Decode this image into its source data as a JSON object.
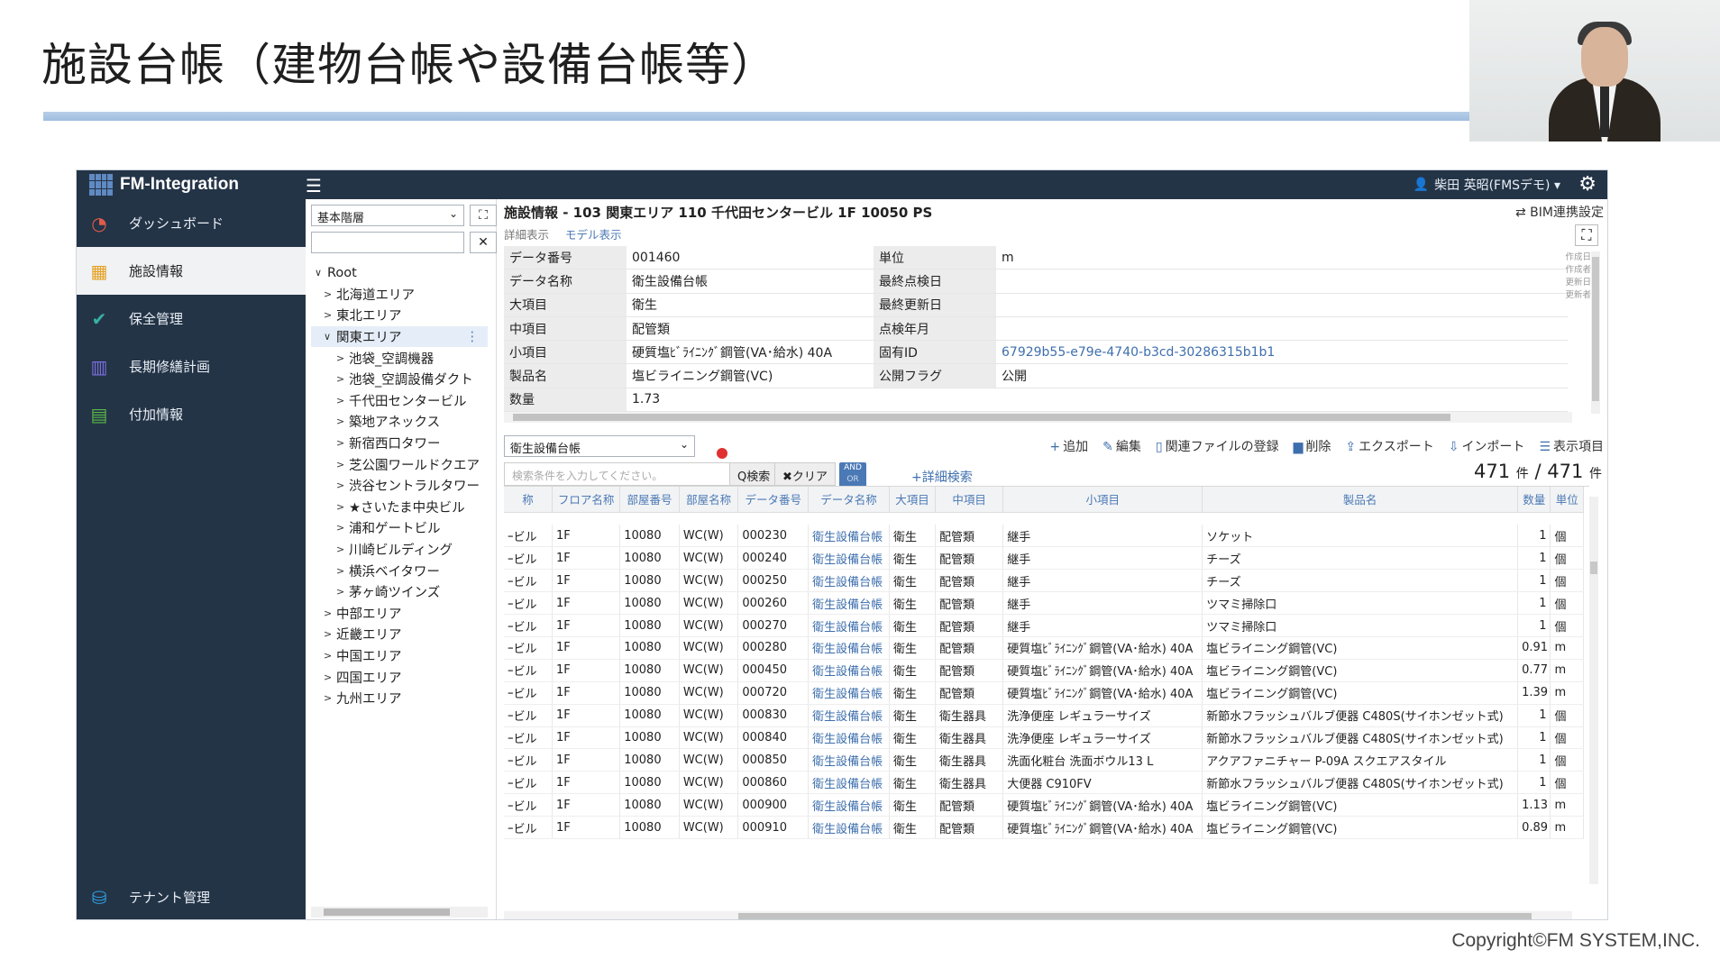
{
  "slide": {
    "title": "施設台帳（建物台帳や設備台帳等）",
    "copyright": "Copyright©FM SYSTEM,INC."
  },
  "app": {
    "brand": "FM-Integration",
    "user": "柴田 英昭(FMSデモ) ▾",
    "sidebar": [
      {
        "label": "ダッシュボード",
        "icon": "gauge-icon",
        "glyph": "◔",
        "color": "#e05a4a"
      },
      {
        "label": "施設情報",
        "icon": "building-icon",
        "glyph": "▦",
        "color": "#e5a020"
      },
      {
        "label": "保全管理",
        "icon": "check-icon",
        "glyph": "✔",
        "color": "#37b1a6"
      },
      {
        "label": "長期修繕計画",
        "icon": "bar-chart-icon",
        "glyph": "▥",
        "color": "#7d6fe0"
      },
      {
        "label": "付加情報",
        "icon": "list-icon",
        "glyph": "▤",
        "color": "#58b848"
      }
    ],
    "sidebar_bottom": {
      "label": "テナント管理",
      "icon": "database-icon",
      "glyph": "⛁",
      "color": "#2ea0e0"
    },
    "tree": {
      "select_value": "基本階層",
      "nodes": [
        {
          "label": "Root",
          "level": 0,
          "chev": "∨"
        },
        {
          "label": "北海道エリア",
          "level": 1,
          "chev": ">"
        },
        {
          "label": "東北エリア",
          "level": 1,
          "chev": ">"
        },
        {
          "label": "関東エリア",
          "level": 1,
          "chev": "∨",
          "highlight": true
        },
        {
          "label": "池袋_空調機器",
          "level": 2,
          "chev": ">"
        },
        {
          "label": "池袋_空調設備ダクト",
          "level": 2,
          "chev": ">"
        },
        {
          "label": "千代田センタービル",
          "level": 2,
          "chev": ">"
        },
        {
          "label": "築地アネックス",
          "level": 2,
          "chev": ">"
        },
        {
          "label": "新宿西口タワー",
          "level": 2,
          "chev": ">"
        },
        {
          "label": "芝公園ワールドクエア",
          "level": 2,
          "chev": ">"
        },
        {
          "label": "渋谷セントラルタワー",
          "level": 2,
          "chev": ">"
        },
        {
          "label": "★さいたま中央ビル",
          "level": 2,
          "chev": ">"
        },
        {
          "label": "浦和ゲートビル",
          "level": 2,
          "chev": ">"
        },
        {
          "label": "川崎ビルディング",
          "level": 2,
          "chev": ">"
        },
        {
          "label": "横浜ベイタワー",
          "level": 2,
          "chev": ">"
        },
        {
          "label": "茅ヶ崎ツインズ",
          "level": 2,
          "chev": ">"
        },
        {
          "label": "中部エリア",
          "level": 1,
          "chev": ">"
        },
        {
          "label": "近畿エリア",
          "level": 1,
          "chev": ">"
        },
        {
          "label": "中国エリア",
          "level": 1,
          "chev": ">"
        },
        {
          "label": "四国エリア",
          "level": 1,
          "chev": ">"
        },
        {
          "label": "九州エリア",
          "level": 1,
          "chev": ">"
        }
      ]
    },
    "main": {
      "breadcrumb": "施設情報 - 103 関東エリア 110 千代田センタービル 1F 10050 PS",
      "bim_link": "⇄ BIM連携設定",
      "tabs": [
        "詳細表示",
        "モデル表示"
      ],
      "detail_rows": [
        {
          "k1": "データ番号",
          "v1": "001460",
          "k2": "単位",
          "v2": "m"
        },
        {
          "k1": "データ名称",
          "v1": "衛生設備台帳",
          "k2": "最終点検日",
          "v2": ""
        },
        {
          "k1": "大項目",
          "v1": "衛生",
          "k2": "最終更新日",
          "v2": ""
        },
        {
          "k1": "中項目",
          "v1": "配管類",
          "k2": "点検年月",
          "v2": ""
        },
        {
          "k1": "小項目",
          "v1": "硬質塩ﾋﾞﾗｲﾆﾝｸﾞ鋼管(VA･給水) 40A",
          "k2": "固有ID",
          "v2": "67929b55-e79e-4740-b3cd-30286315b1b1"
        },
        {
          "k1": "製品名",
          "v1": "塩ビライニング鋼管(VC)",
          "k2": "公開フラグ",
          "v2": "公開"
        },
        {
          "k1": "数量",
          "v1": "1.73",
          "k2": "",
          "v2": ""
        }
      ],
      "meta": [
        "作成日",
        "作成者",
        "更新日",
        "更新者"
      ],
      "list_select": "衛生設備台帳",
      "toolbar": [
        {
          "icon": "plus-icon",
          "glyph": "+",
          "label": "追加"
        },
        {
          "icon": "pencil-icon",
          "glyph": "✎",
          "label": "編集"
        },
        {
          "icon": "file-icon",
          "glyph": "▯",
          "label": "関連ファイルの登録"
        },
        {
          "icon": "trash-icon",
          "glyph": "▆",
          "label": "削除"
        },
        {
          "icon": "export-icon",
          "glyph": "⇪",
          "label": "エクスポート"
        },
        {
          "icon": "import-icon",
          "glyph": "⇩",
          "label": "インポート"
        },
        {
          "icon": "columns-icon",
          "glyph": "☰",
          "label": "表示項目"
        }
      ],
      "search_placeholder": "検索条件を入力してください。",
      "search_btn": "Q検索",
      "clear_btn": "✖クリア",
      "andor": [
        "AND",
        "OR"
      ],
      "advanced_search": "+詳細検索",
      "count": {
        "shown": "471",
        "total": "471",
        "unit": "件",
        "sep": "/"
      },
      "columns": [
        "称",
        "フロア名称",
        "部屋番号",
        "部屋名称",
        "データ番号",
        "データ名称",
        "大項目",
        "中項目",
        "小項目",
        "製品名",
        "数量",
        "単位"
      ],
      "rows": [
        [
          "ｰビル",
          "1F",
          "10080",
          "WC(W)",
          "000230",
          "衛生設備台帳",
          "衛生",
          "配管類",
          "継手",
          "ソケット",
          "1",
          "個"
        ],
        [
          "ｰビル",
          "1F",
          "10080",
          "WC(W)",
          "000240",
          "衛生設備台帳",
          "衛生",
          "配管類",
          "継手",
          "チーズ",
          "1",
          "個"
        ],
        [
          "ｰビル",
          "1F",
          "10080",
          "WC(W)",
          "000250",
          "衛生設備台帳",
          "衛生",
          "配管類",
          "継手",
          "チーズ",
          "1",
          "個"
        ],
        [
          "ｰビル",
          "1F",
          "10080",
          "WC(W)",
          "000260",
          "衛生設備台帳",
          "衛生",
          "配管類",
          "継手",
          "ツマミ掃除口",
          "1",
          "個"
        ],
        [
          "ｰビル",
          "1F",
          "10080",
          "WC(W)",
          "000270",
          "衛生設備台帳",
          "衛生",
          "配管類",
          "継手",
          "ツマミ掃除口",
          "1",
          "個"
        ],
        [
          "ｰビル",
          "1F",
          "10080",
          "WC(W)",
          "000280",
          "衛生設備台帳",
          "衛生",
          "配管類",
          "硬質塩ﾋﾞﾗｲﾆﾝｸﾞ鋼管(VA･給水) 40A",
          "塩ビライニング鋼管(VC)",
          "0.91",
          "m"
        ],
        [
          "ｰビル",
          "1F",
          "10080",
          "WC(W)",
          "000450",
          "衛生設備台帳",
          "衛生",
          "配管類",
          "硬質塩ﾋﾞﾗｲﾆﾝｸﾞ鋼管(VA･給水) 40A",
          "塩ビライニング鋼管(VC)",
          "0.77",
          "m"
        ],
        [
          "ｰビル",
          "1F",
          "10080",
          "WC(W)",
          "000720",
          "衛生設備台帳",
          "衛生",
          "配管類",
          "硬質塩ﾋﾞﾗｲﾆﾝｸﾞ鋼管(VA･給水) 40A",
          "塩ビライニング鋼管(VC)",
          "1.39",
          "m"
        ],
        [
          "ｰビル",
          "1F",
          "10080",
          "WC(W)",
          "000830",
          "衛生設備台帳",
          "衛生",
          "衛生器具",
          "洗浄便座 レギュラーサイズ",
          "新節水フラッシュバルブ便器 C480S(サイホンゼット式)",
          "1",
          "個"
        ],
        [
          "ｰビル",
          "1F",
          "10080",
          "WC(W)",
          "000840",
          "衛生設備台帳",
          "衛生",
          "衛生器具",
          "洗浄便座 レギュラーサイズ",
          "新節水フラッシュバルブ便器 C480S(サイホンゼット式)",
          "1",
          "個"
        ],
        [
          "ｰビル",
          "1F",
          "10080",
          "WC(W)",
          "000850",
          "衛生設備台帳",
          "衛生",
          "衛生器具",
          "洗面化粧台 洗面ボウル13 L",
          "アクアファニチャー P-09A スクエアスタイル",
          "1",
          "個"
        ],
        [
          "ｰビル",
          "1F",
          "10080",
          "WC(W)",
          "000860",
          "衛生設備台帳",
          "衛生",
          "衛生器具",
          "大便器 C910FV",
          "新節水フラッシュバルブ便器 C480S(サイホンゼット式)",
          "1",
          "個"
        ],
        [
          "ｰビル",
          "1F",
          "10080",
          "WC(W)",
          "000900",
          "衛生設備台帳",
          "衛生",
          "配管類",
          "硬質塩ﾋﾞﾗｲﾆﾝｸﾞ鋼管(VA･給水) 40A",
          "塩ビライニング鋼管(VC)",
          "1.13",
          "m"
        ],
        [
          "ｰビル",
          "1F",
          "10080",
          "WC(W)",
          "000910",
          "衛生設備台帳",
          "衛生",
          "配管類",
          "硬質塩ﾋﾞﾗｲﾆﾝｸﾞ鋼管(VA･給水) 40A",
          "塩ビライニング鋼管(VC)",
          "0.89",
          "m"
        ]
      ]
    }
  }
}
